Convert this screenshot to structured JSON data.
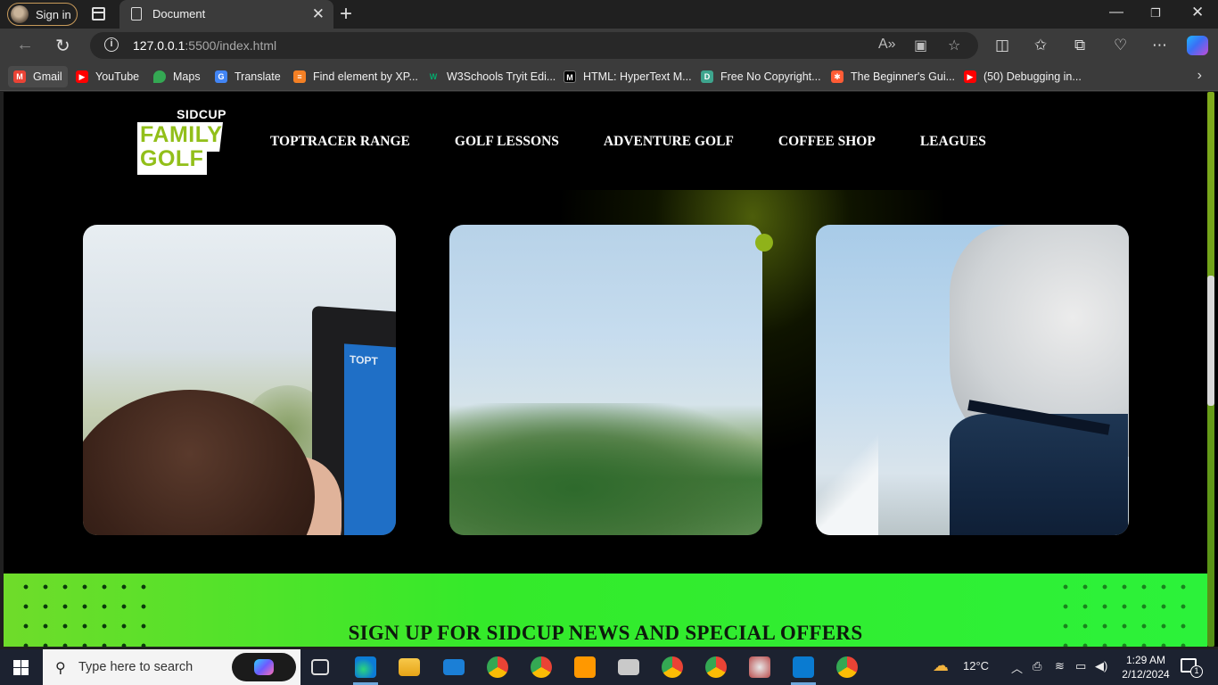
{
  "browser": {
    "signin_label": "Sign in",
    "tab_title": "Document",
    "url_host": "127.0.0.1",
    "url_rest": ":5500/index.html",
    "bookmarks": [
      {
        "label": "Gmail",
        "color": "#ea4335"
      },
      {
        "label": "YouTube",
        "color": "#ff0000"
      },
      {
        "label": "Maps",
        "color": "#34a853"
      },
      {
        "label": "Translate",
        "color": "#4285f4"
      },
      {
        "label": "Find element by XP...",
        "color": "#f48024"
      },
      {
        "label": "W3Schools Tryit Edi...",
        "color": "#04aa6d"
      },
      {
        "label": "HTML: HyperText M...",
        "color": "#000000"
      },
      {
        "label": "Free No Copyright...",
        "color": "#3ea58e"
      },
      {
        "label": "The Beginner's Gui...",
        "color": "#ff5c35"
      },
      {
        "label": "(50) Debugging in...",
        "color": "#ff0000"
      }
    ]
  },
  "site": {
    "logo": {
      "top": "SIDCUP",
      "line1": "FAMILY",
      "line2": "GOLF"
    },
    "nav": [
      "TOPTRACER RANGE",
      "GOLF LESSONS",
      "ADVENTURE GOLF",
      "COFFEE SHOP",
      "LEAGUES"
    ],
    "card1_screen_text": "TOPT",
    "signup_heading": "SIGN UP FOR SIDCUP NEWS AND SPECIAL OFFERS",
    "accent_color": "#92bf1a"
  },
  "taskbar": {
    "search_placeholder": "Type here to search",
    "weather": "12°C",
    "time": "1:29 AM",
    "date": "2/12/2024",
    "notification_count": "1"
  }
}
